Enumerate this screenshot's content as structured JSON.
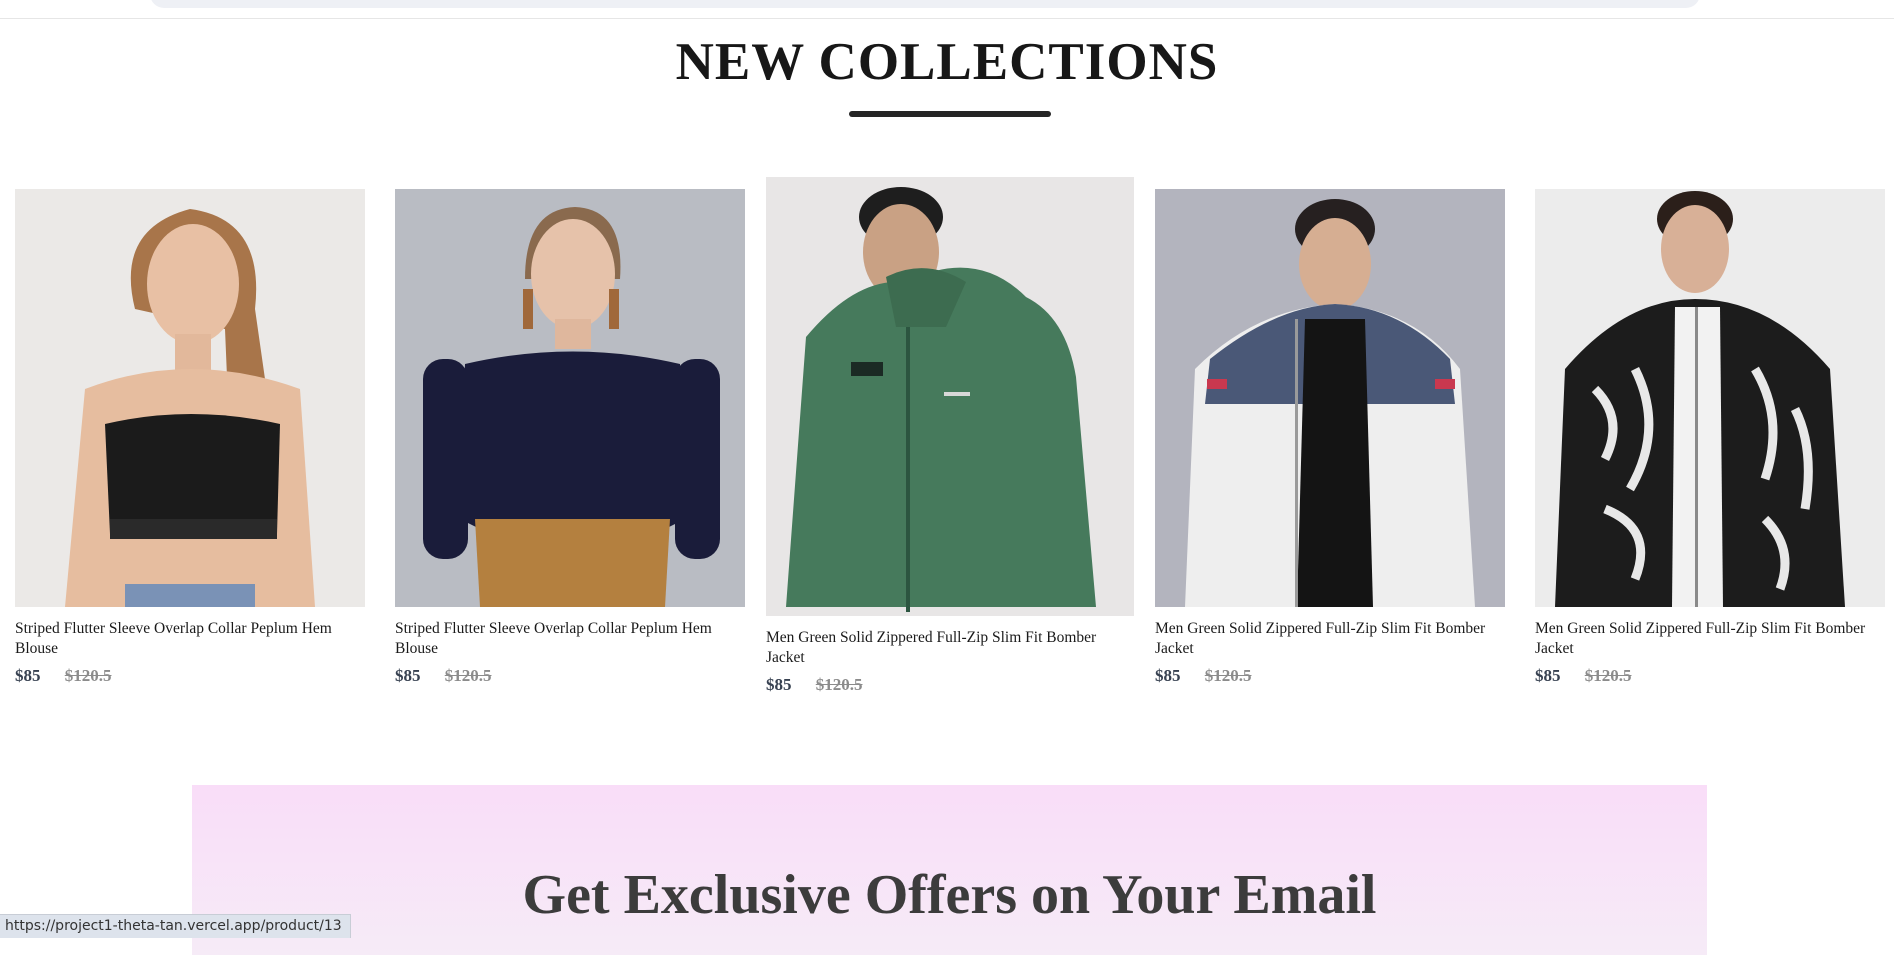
{
  "section": {
    "title": "NEW COLLECTIONS"
  },
  "products": [
    {
      "name": "Striped Flutter Sleeve Overlap Collar Peplum Hem Blouse",
      "price_new": "$85",
      "price_old": "$120.5",
      "image_icon": "woman-black-crop-top-image"
    },
    {
      "name": "Striped Flutter Sleeve Overlap Collar Peplum Hem Blouse",
      "price_new": "$85",
      "price_old": "$120.5",
      "image_icon": "woman-navy-sweater-image"
    },
    {
      "name": "Men Green Solid Zippered Full-Zip Slim Fit Bomber Jacket",
      "price_new": "$85",
      "price_old": "$120.5",
      "image_icon": "man-green-hoodie-image"
    },
    {
      "name": "Men Green Solid Zippered Full-Zip Slim Fit Bomber Jacket",
      "price_new": "$85",
      "price_old": "$120.5",
      "image_icon": "man-white-puffer-jacket-image"
    },
    {
      "name": "Men Green Solid Zippered Full-Zip Slim Fit Bomber Jacket",
      "price_new": "$85",
      "price_old": "$120.5",
      "image_icon": "man-marble-print-bomber-image"
    }
  ],
  "offers": {
    "title": "Get Exclusive Offers on Your Email"
  },
  "status_bar": {
    "url": "https://project1-theta-tan.vercel.app/product/13"
  },
  "colors": {
    "underline": "#252525",
    "price_new": "#374151",
    "price_old": "#8b8b8b",
    "banner_top": "#f9ddf8",
    "banner_bottom": "#f6ebf7"
  }
}
